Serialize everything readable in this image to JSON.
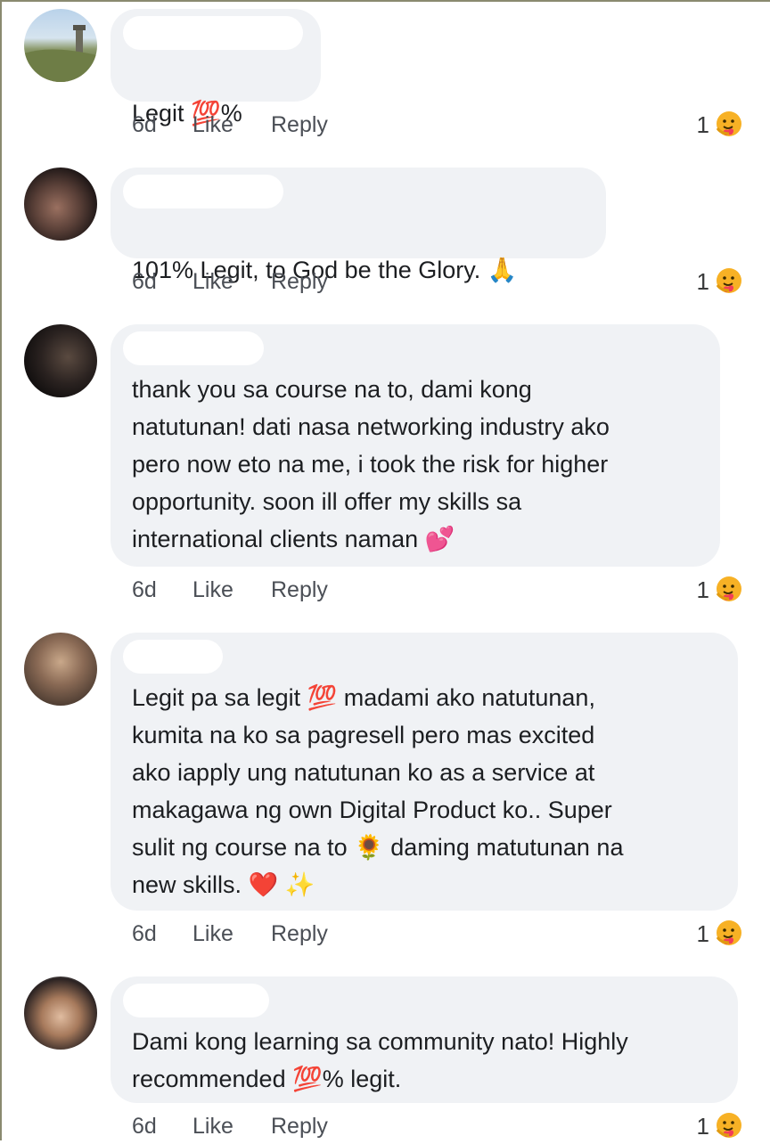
{
  "comments": [
    {
      "text_parts": [
        "Legit ",
        "💯",
        "%"
      ],
      "time": "6d",
      "like": "Like",
      "reply": "Reply",
      "reaction_count": "1"
    },
    {
      "text_parts": [
        "101% Legit, to God be the Glory. ",
        "🙏"
      ],
      "time": "6d",
      "like": "Like",
      "reply": "Reply",
      "reaction_count": "1"
    },
    {
      "text": "thank you sa course na to, dami kong\nnatutunan! dati nasa networking industry ako\npero now eto na me, i took the risk for higher\nopportunity. soon ill offer my skills sa\ninternational clients naman ",
      "emoji": "💕",
      "time": "6d",
      "like": "Like",
      "reply": "Reply",
      "reaction_count": "1"
    },
    {
      "line1_a": "Legit pa sa legit ",
      "line1_emoji": "💯",
      "line1_b": " madami ako natutunan,",
      "middle": "kumita na ko sa pagresell pero mas excited\nako iapply ung natutunan ko as a service at\nmakagawa ng own Digital Product ko.. Super",
      "line5_a": "sulit ng course na to ",
      "line5_emoji": "🌻",
      "line5_b": " daming matutunan na",
      "line6": "new skills. ",
      "line6_emoji1": "❤️",
      "line6_emoji2": "✨",
      "time": "6d",
      "like": "Like",
      "reply": "Reply",
      "reaction_count": "1"
    },
    {
      "line1": "Dami kong learning sa community nato! Highly",
      "line2_a": "recommended ",
      "line2_emoji": "💯",
      "line2_b": "% legit.",
      "time": "6d",
      "like": "Like",
      "reply": "Reply",
      "reaction_count": "1"
    }
  ],
  "colors": {
    "bubble": "#f0f2f5",
    "meta_text": "#4b4f56",
    "reaction_face": "#f7b125",
    "reaction_heart": "#f33e58"
  },
  "icons": {
    "reaction": "care-reaction-icon"
  }
}
